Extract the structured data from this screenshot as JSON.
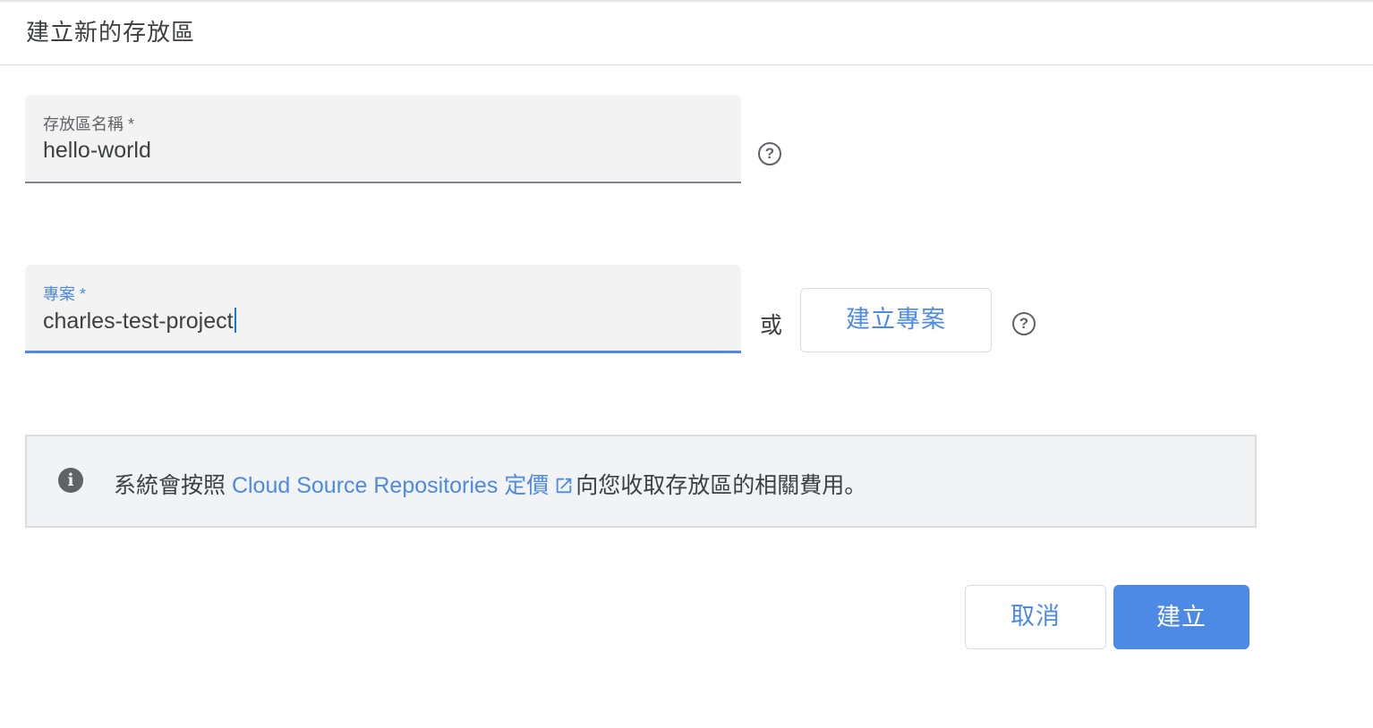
{
  "dialog": {
    "title": "建立新的存放區"
  },
  "repository_name_field": {
    "label": "存放區名稱 *",
    "value": "hello-world"
  },
  "project_field": {
    "label": "專案 *",
    "value": "charles-test-project",
    "focused": true
  },
  "or_text": "或",
  "create_project_button": {
    "label": "建立專案"
  },
  "help_icon": "?",
  "info_notice": {
    "icon": "i",
    "prefix": "系統會按照 ",
    "link_text": "Cloud Source Repositories 定價",
    "suffix": "向您收取存放區的相關費用。"
  },
  "actions": {
    "cancel_label": "取消",
    "create_label": "建立"
  },
  "colors": {
    "accent": "#4d8ae6",
    "text": "#3c4043",
    "field_bg": "#f3f3f3",
    "info_bg": "#f1f3f4"
  },
  "icons": {
    "help": "help-circle-icon",
    "info": "info-icon",
    "external_link": "open-in-new-icon"
  }
}
